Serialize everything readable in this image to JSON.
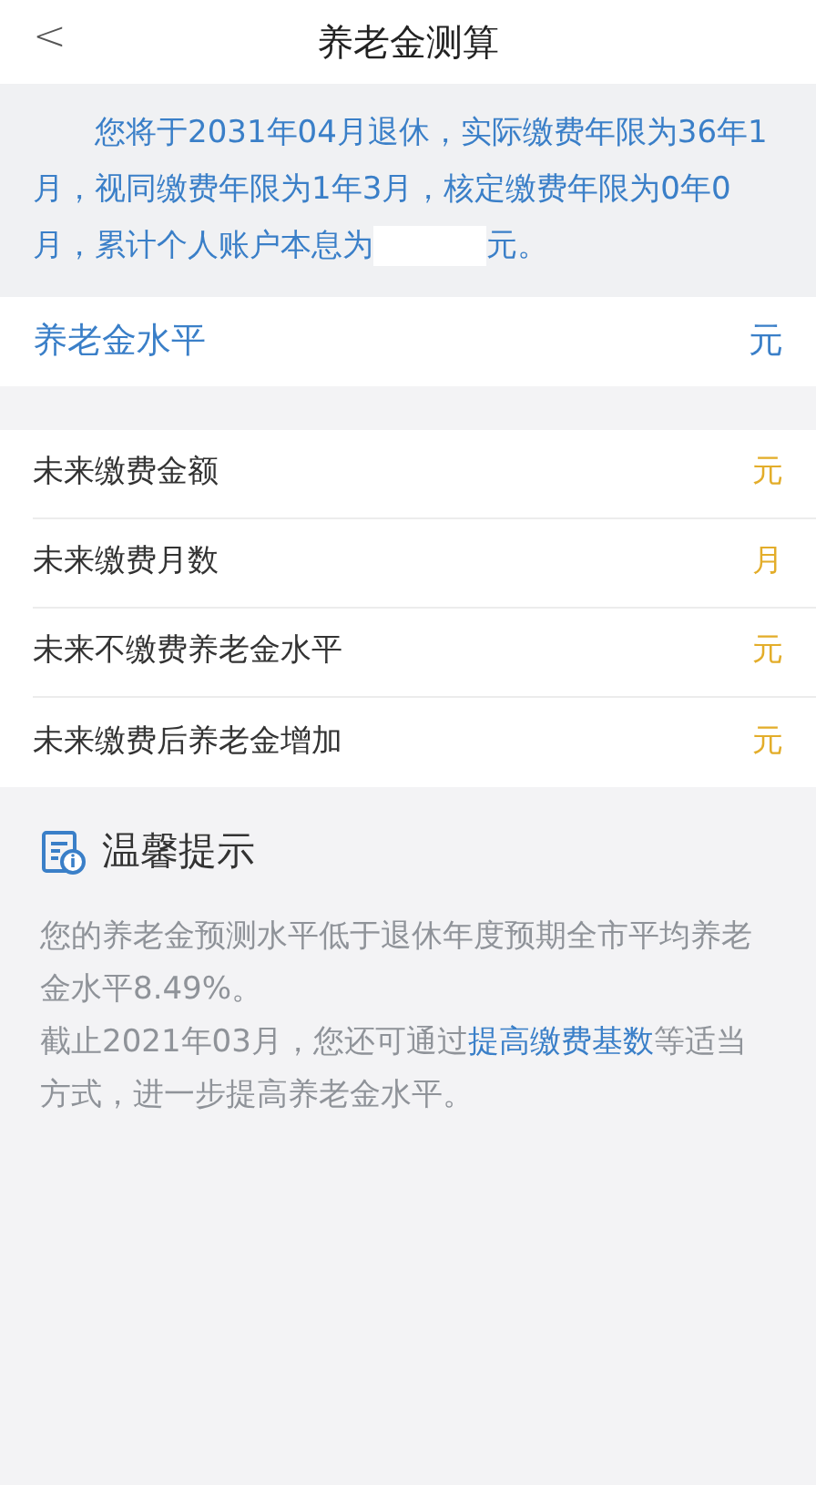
{
  "header": {
    "back": "<",
    "title": "养老金测算"
  },
  "summary": {
    "before": "您将于2031年04月退休，实际缴费年限为36年1月，视同缴费年限为1年3月，核定缴费年限为0年0月，累计个人账户本息为",
    "redacted": true,
    "after": "元。"
  },
  "pension_level": {
    "label": "养老金水平",
    "unit": "元"
  },
  "rows": [
    {
      "label": "未来缴费金额",
      "unit": "元"
    },
    {
      "label": "未来缴费月数",
      "unit": "月"
    },
    {
      "label": "未来不缴费养老金水平",
      "unit": "元"
    },
    {
      "label": "未来缴费后养老金增加",
      "unit": "元"
    }
  ],
  "tips": {
    "title": "温馨提示",
    "paragraphs": [
      {
        "before": "您的养老金预测水平低于退休年度预期全市平均养老金水平8.49%。"
      },
      {
        "before": "截止2021年03月，您还可通过",
        "link": "提高缴费基数",
        "after": "等适当方式，进一步提高养老金水平。"
      }
    ]
  }
}
